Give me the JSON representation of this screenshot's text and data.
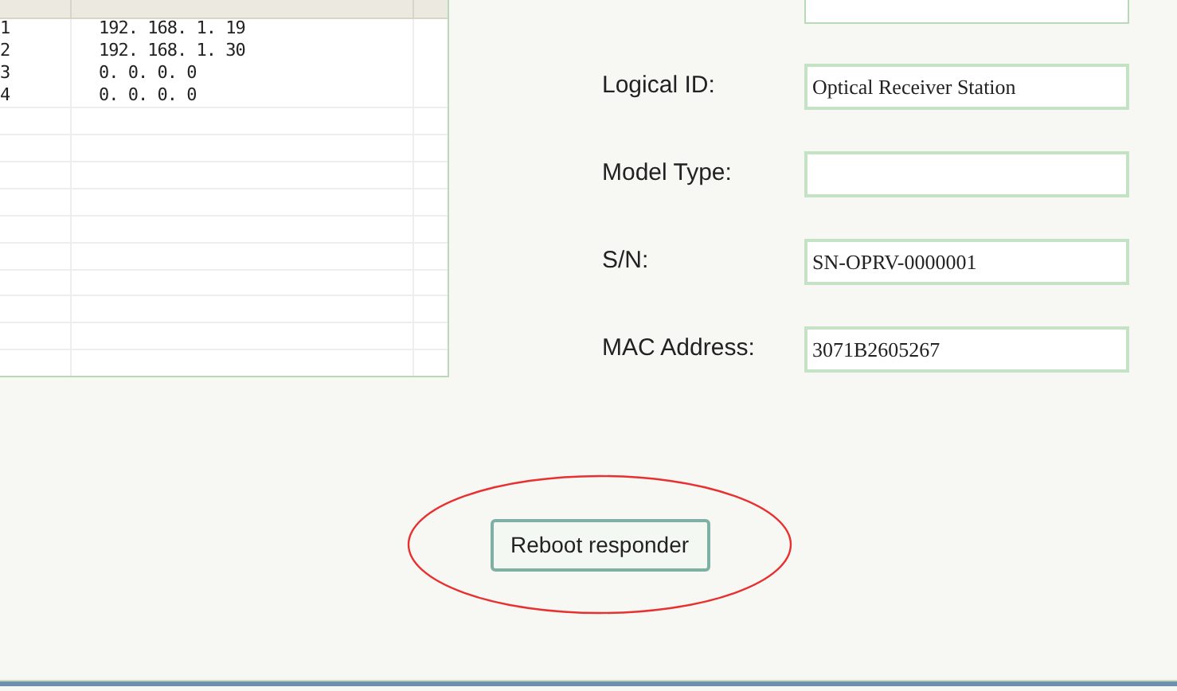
{
  "table": {
    "rows": [
      {
        "column_1": "1",
        "column_2": "192. 168. 1. 19"
      },
      {
        "column_1": "2",
        "column_2": "192. 168. 1. 30"
      },
      {
        "column_1": "3",
        "column_2": "0. 0. 0. 0"
      },
      {
        "column_1": "4",
        "column_2": "0. 0. 0. 0"
      }
    ]
  },
  "form": {
    "fields": [
      {
        "label": "Logical ID:",
        "value": "Optical Receiver Station"
      },
      {
        "label": "Model Type:"
      },
      {
        "label": "S/N:",
        "value": "SN-OPRV-0000001"
      },
      {
        "label": "MAC Address:",
        "value": "3071B2605267"
      }
    ]
  },
  "reboot_button": {
    "label": "Reboot responder",
    "highlighted": true
  }
}
